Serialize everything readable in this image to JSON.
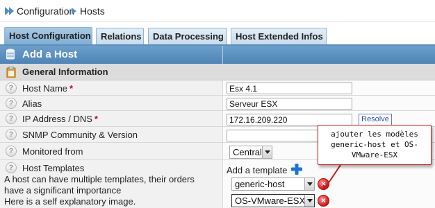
{
  "breadcrumb": {
    "items": [
      "Configuration",
      "Hosts"
    ]
  },
  "tabs": [
    {
      "label": "Host Configuration",
      "active": true
    },
    {
      "label": "Relations",
      "active": false
    },
    {
      "label": "Data Processing",
      "active": false
    },
    {
      "label": "Host Extended Infos",
      "active": false
    }
  ],
  "section_title": "Add a Host",
  "subsection_title": "General Information",
  "fields": {
    "host_name": {
      "label": "Host Name",
      "required": "*",
      "value": "Esx 4.1"
    },
    "alias": {
      "label": "Alias",
      "value": "Serveur ESX"
    },
    "ip": {
      "label": "IP Address / DNS",
      "required": "*",
      "value": "172.16.209.220",
      "button": "Resolve"
    },
    "snmp": {
      "label": "SNMP Community & Version",
      "value": ""
    },
    "monitored_from": {
      "label": "Monitored from",
      "value": "Central"
    },
    "templates": {
      "label": "Host Templates",
      "help_line1": "A host can have multiple templates, their orders",
      "help_line2": "have a significant importance",
      "help_line3": "Here is a self explanatory image.",
      "add_label": "Add a template",
      "items": [
        "generic-host",
        "OS-VMware-ESX"
      ]
    }
  },
  "callout": {
    "line1": "ajouter les modèles",
    "line2": "generic-host et OS-",
    "line3": "VMware-ESX"
  },
  "icons": {
    "help": "?",
    "delete": "×",
    "accent": "#4d84b6",
    "delete_color": "#d11a1a",
    "plus_color": "#1e73d6",
    "callout_border": "#c61b1b"
  }
}
